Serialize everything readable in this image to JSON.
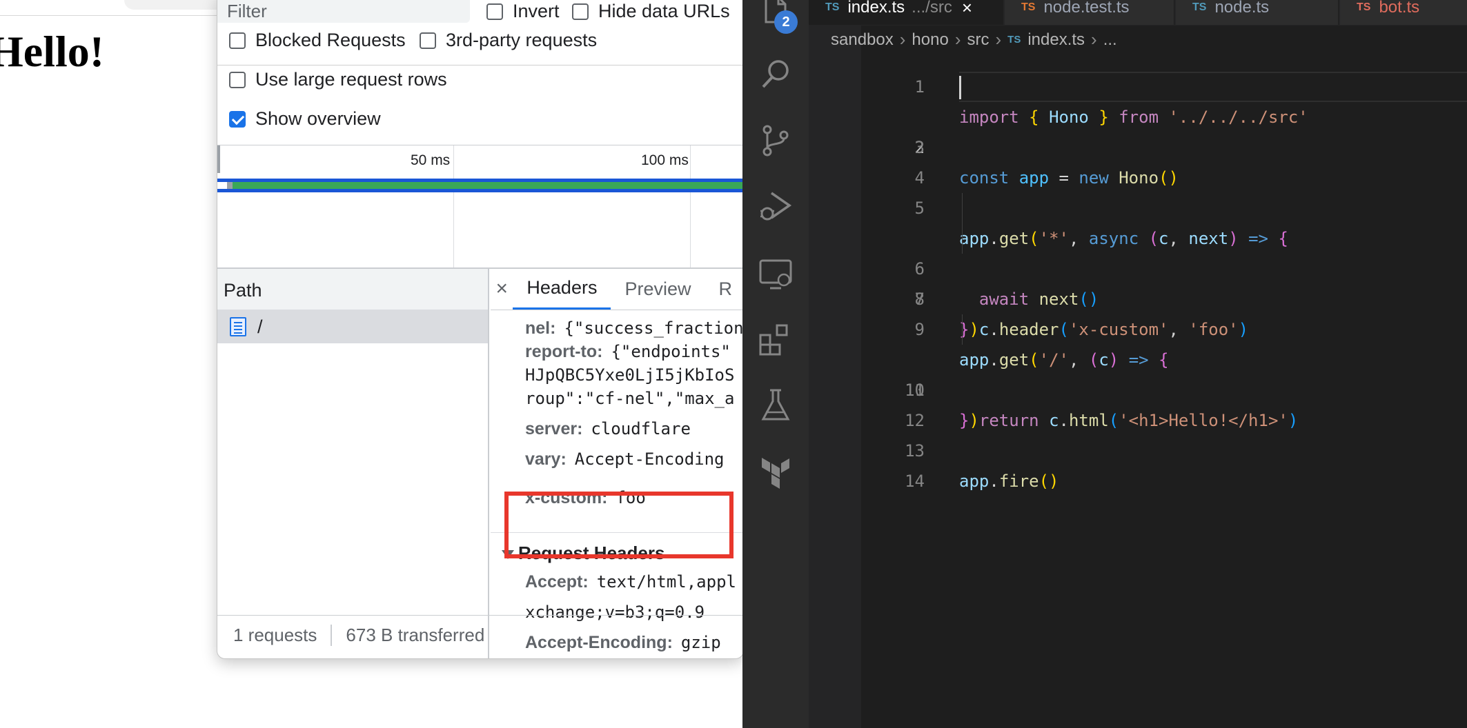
{
  "browser_page": {
    "heading": "Hello!"
  },
  "devtools": {
    "filter_placeholder": "Filter",
    "options": {
      "invert": {
        "label": "Invert",
        "checked": false
      },
      "hide_data_urls": {
        "label": "Hide data URLs",
        "checked": false
      },
      "blocked_requests": {
        "label": "Blocked Requests",
        "checked": false
      },
      "third_party": {
        "label": "3rd-party requests",
        "checked": false
      },
      "large_rows": {
        "label": "Use large request rows",
        "checked": false
      },
      "show_overview": {
        "label": "Show overview",
        "checked": true
      }
    },
    "overview": {
      "tick_1": "50 ms",
      "tick_2": "100 ms"
    },
    "path_column_header": "Path",
    "requests": [
      {
        "path": "/"
      }
    ],
    "status": {
      "requests": "1 requests",
      "transferred": "673 B transferred"
    },
    "detail_tabs": {
      "close": "×",
      "headers": "Headers",
      "preview": "Preview",
      "response_partial": "R"
    },
    "response_headers": [
      {
        "name": "nel:",
        "value": "{\"success_fraction"
      },
      {
        "name": "report-to:",
        "value": "{\"endpoints\""
      },
      {
        "name": "",
        "value": "HJpQBC5Yxe0LjI5jKbIoS"
      },
      {
        "name": "",
        "value": "roup\":\"cf-nel\",\"max_a"
      },
      {
        "name": "server:",
        "value": "cloudflare"
      },
      {
        "name": "vary:",
        "value": "Accept-Encoding"
      },
      {
        "name": "x-custom:",
        "value": "foo"
      }
    ],
    "request_headers_title": "Request Headers",
    "request_headers": [
      {
        "name": "Accept:",
        "value": "text/html,appl"
      },
      {
        "name": "",
        "value": "xchange;v=b3;q=0.9"
      },
      {
        "name": "Accept-Encoding:",
        "value": "gzip"
      }
    ]
  },
  "vscode": {
    "scm_badge": "2",
    "tabs": [
      {
        "badge": "TS",
        "name": "index.ts",
        "hint": ".../src",
        "active": true
      },
      {
        "badge": "TS",
        "name": "node.test.ts",
        "active": false
      },
      {
        "badge": "TS",
        "name": "node.ts",
        "active": false
      },
      {
        "badge": "TS",
        "name": "bot.ts",
        "active": false
      }
    ],
    "breadcrumbs": [
      "sandbox",
      "hono",
      "src",
      "index.ts",
      "..."
    ],
    "line_numbers": [
      "1",
      "2",
      "3",
      "4",
      "5",
      "6",
      "7",
      "8",
      "9",
      "10",
      "11",
      "12",
      "13",
      "14"
    ],
    "current_line": 2,
    "code_lines": [
      "import { Hono } from '../../../src'",
      "",
      "const app = new Hono()",
      "",
      "app.get('*', async (c, next) => {",
      "  await next()",
      "  c.header('x-custom', 'foo')",
      "})",
      "app.get('/', (c) => {",
      "  return c.html('<h1>Hello!</h1>')",
      "})",
      "",
      "app.fire()",
      ""
    ]
  },
  "colors": {
    "highlight_box": "#e8372c",
    "accent_blue": "#1a73e8",
    "timeline_green": "#3aa757"
  }
}
